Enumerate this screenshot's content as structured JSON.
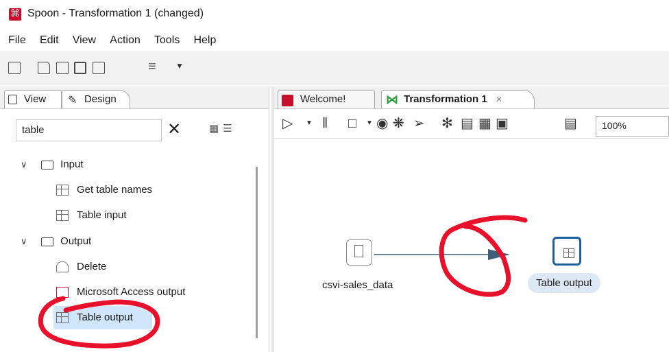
{
  "window": {
    "title": "Spoon - Transformation 1 (changed)"
  },
  "menu": [
    "File",
    "Edit",
    "View",
    "Action",
    "Tools",
    "Help"
  ],
  "toolbar_icons": [
    "new-file-icon",
    "open-folder-icon",
    "explore-repository-icon",
    "save-icon",
    "save-as-icon",
    "layers-icon",
    "dropdown-arrow-icon"
  ],
  "left_panel": {
    "tabs": [
      "View",
      "Design"
    ],
    "search": {
      "value": "table"
    },
    "tree": {
      "input": {
        "label": "Input",
        "items": [
          "Get table names",
          "Table input"
        ]
      },
      "output": {
        "label": "Output",
        "items": [
          "Delete",
          "Microsoft Access output",
          "Table output"
        ]
      }
    },
    "selected_item": "Table output"
  },
  "right_panel": {
    "tabs": [
      "Welcome!",
      "Transformation 1"
    ],
    "zoom": "100%",
    "canvas_toolbar_icons": [
      "run-icon",
      "run-dropdown-icon",
      "pause-icon",
      "stop-icon",
      "stop-dropdown-icon",
      "preview-icon",
      "debug-icon",
      "replay-icon",
      "verify-icon",
      "impact-icon",
      "sql-icon",
      "explore-db-icon",
      "show-results-icon"
    ],
    "steps": [
      {
        "name": "csvi-sales_data",
        "icon": "text-file-input-icon"
      },
      {
        "name": "Table output",
        "icon": "table-output-icon"
      }
    ]
  },
  "colors": {
    "accent_blue": "#1f5f9e",
    "selection": "#cfe5fa",
    "annotation_red": "#e8102a",
    "app_red": "#c8102e",
    "hop_arrow": "#3f5e78"
  }
}
